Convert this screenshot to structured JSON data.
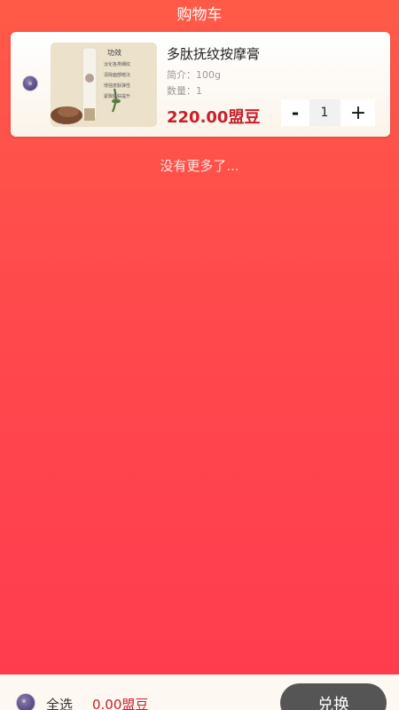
{
  "header": {
    "title": "购物车"
  },
  "cart": {
    "items": [
      {
        "name": "多肽抚纹按摩膏",
        "desc": "简介：100g",
        "qty_label": "数量：1",
        "price": "220.00盟豆",
        "qty": "1",
        "image_text": {
          "heading": "功效",
          "lines": [
            "淡化各类细纹",
            "清除面部暗沉",
            "增强皮肤弹性",
            "紧致肌肤提升"
          ]
        }
      }
    ],
    "stepper": {
      "minus": "-",
      "plus": "+"
    }
  },
  "no_more_text": "没有更多了...",
  "footer": {
    "select_all": "全选",
    "total": "0.00盟豆",
    "redeem": "兑换"
  },
  "colors": {
    "background_top": "#ff5a48",
    "background_bottom": "#ff3b4f",
    "price": "#c8202a",
    "redeem_button": "#555555"
  },
  "icons": {
    "item_select": "radio-circle-icon",
    "select_all": "radio-circle-icon"
  }
}
